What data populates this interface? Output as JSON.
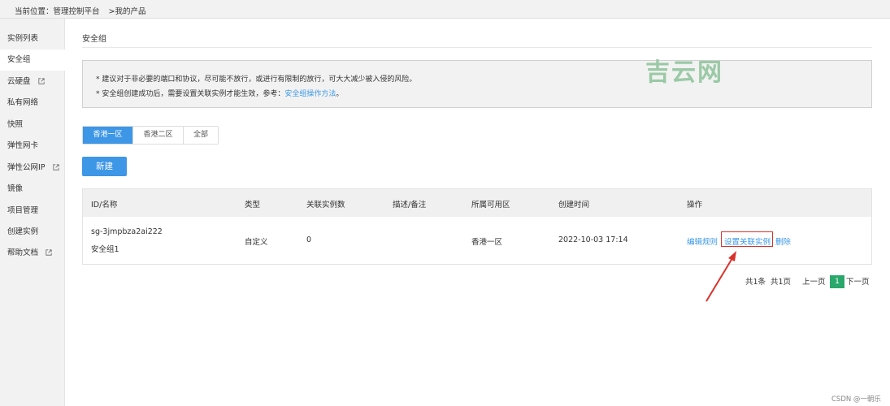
{
  "breadcrumb": {
    "prefix": "当前位置：管理控制平台",
    "current": ">我的产品"
  },
  "sidebar": {
    "items": [
      {
        "label": "实例列表"
      },
      {
        "label": "安全组"
      },
      {
        "label": "云硬盘"
      },
      {
        "label": "私有网络"
      },
      {
        "label": "快照"
      },
      {
        "label": "弹性网卡"
      },
      {
        "label": "弹性公网IP"
      },
      {
        "label": "镜像"
      },
      {
        "label": "项目管理"
      },
      {
        "label": "创建实例"
      },
      {
        "label": "帮助文档"
      }
    ],
    "active_index": 1
  },
  "section_title": "安全组",
  "watermark": "吉云网",
  "notice": {
    "line1": "* 建议对于非必要的端口和协议，尽可能不放行，或进行有限制的放行，可大大减少被入侵的风险。",
    "line2_text": "* 安全组创建成功后，需要设置关联实例才能生效，参考：",
    "line2_link": "安全组操作方法",
    "line2_end": "。"
  },
  "region_tabs": [
    {
      "label": "香港一区",
      "active": true
    },
    {
      "label": "香港二区",
      "active": false
    },
    {
      "label": "全部",
      "active": false
    }
  ],
  "new_button": "新建",
  "table": {
    "headers": [
      "ID/名称",
      "类型",
      "关联实例数",
      "描述/备注",
      "所属可用区",
      "创建时间",
      "操作"
    ],
    "rows": [
      {
        "id": "sg-3jmpbza2ai222",
        "name": "安全组1",
        "type": "自定义",
        "instance_count": "0",
        "description": "",
        "zone": "香港一区",
        "created": "2022-10-03 17:14",
        "actions": [
          "编辑规则",
          "设置关联实例",
          "删除"
        ]
      }
    ]
  },
  "pagination": {
    "total_items": "共1条",
    "total_pages": "共1页",
    "prev": "上一页",
    "current": "1",
    "next": "下一页"
  },
  "footer_watermark": "CSDN @一朝乐",
  "colors": {
    "accent": "#3d96e6",
    "link": "#3a97e8",
    "highlight": "#d8322c",
    "page_current": "#2aa86c"
  }
}
